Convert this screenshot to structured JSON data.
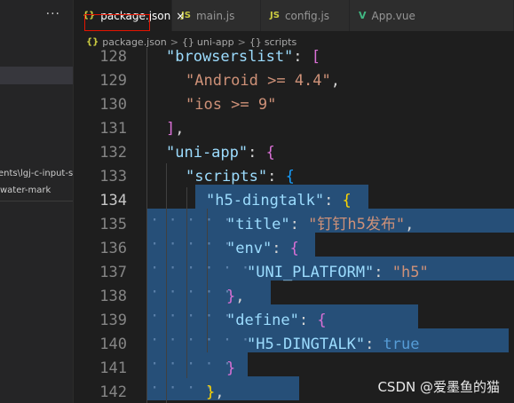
{
  "sidebar": {
    "more_label": "···",
    "path_item_1": "ents\\lgj-c-input-s...",
    "path_item_2": "water-mark"
  },
  "tabs": [
    {
      "icon": "{}",
      "label": "package.json",
      "close": "×",
      "active": true
    },
    {
      "icon": "JS",
      "label": "main.js",
      "active": false
    },
    {
      "icon": "JS",
      "label": "config.js",
      "active": false
    },
    {
      "icon": "V",
      "label": "App.vue",
      "active": false
    }
  ],
  "breadcrumb": {
    "file_icon": "{}",
    "file": "package.json",
    "sep": ">",
    "uni_app_icon": "{}",
    "uni_app": "uni-app",
    "scripts_icon": "{}",
    "scripts": "scripts"
  },
  "editor": {
    "current_line": 134,
    "lines": [
      {
        "n": "128"
      },
      {
        "n": "129"
      },
      {
        "n": "130"
      },
      {
        "n": "131"
      },
      {
        "n": "132"
      },
      {
        "n": "133"
      },
      {
        "n": "134"
      },
      {
        "n": "135"
      },
      {
        "n": "136"
      },
      {
        "n": "137"
      },
      {
        "n": "138"
      },
      {
        "n": "139"
      },
      {
        "n": "140"
      },
      {
        "n": "141"
      },
      {
        "n": "142"
      }
    ],
    "tokens": {
      "browserslist": "\"browserslist\"",
      "android": "\"Android >= 4.4\"",
      "ios": "\"ios >= 9\"",
      "uni_app": "\"uni-app\"",
      "scripts": "\"scripts\"",
      "h5_dingtalk": "\"h5-dingtalk\"",
      "title_key": "\"title\"",
      "title_val": "\"钉钉h5发布\"",
      "env_key": "\"env\"",
      "uni_platform": "\"UNI_PLATFORM\"",
      "h5": "\"h5\"",
      "define_key": "\"define\"",
      "h5_dingtalk_const": "\"H5-DINGTALK\"",
      "true_val": "true"
    }
  },
  "watermark": "CSDN @爱墨鱼的猫"
}
